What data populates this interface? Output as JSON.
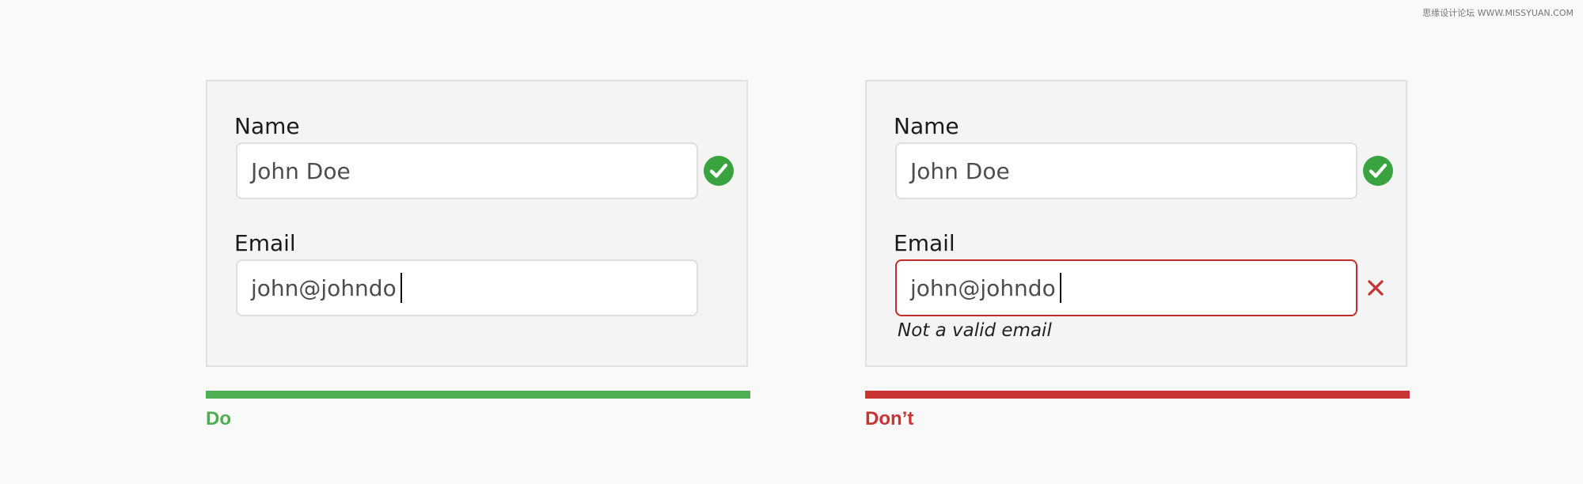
{
  "watermark": "思缘设计论坛 WWW.MISSYUAN.COM",
  "colors": {
    "success": "#4fae54",
    "error": "#c93333",
    "check_circle": "#38a33f"
  },
  "do_example": {
    "name_label": "Name",
    "name_value": "John Doe",
    "name_status_icon": "check-circle-icon",
    "email_label": "Email",
    "email_value": "john@johndo",
    "verdict": "Do"
  },
  "dont_example": {
    "name_label": "Name",
    "name_value": "John Doe",
    "name_status_icon": "check-circle-icon",
    "email_label": "Email",
    "email_value": "john@johndo",
    "email_status_icon": "close-icon",
    "error_message": "Not a valid email",
    "verdict": "Don’t"
  }
}
